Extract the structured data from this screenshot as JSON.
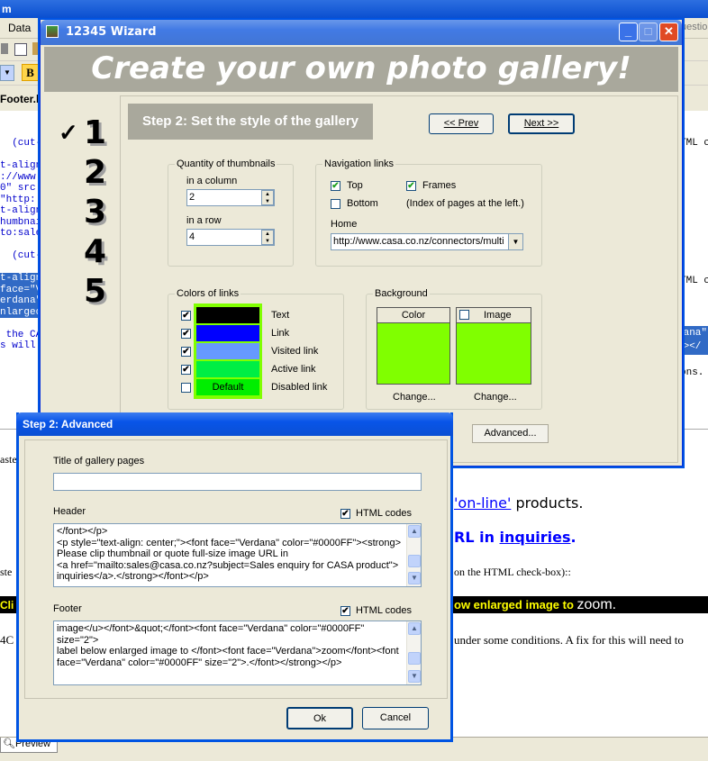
{
  "background_app": {
    "title_fragment": "m",
    "menu_data": "Data",
    "question_fragment": "uestio",
    "file_tab": "Footer.h",
    "bold_button": "B",
    "code_lines_left": [
      {
        "text": "  (cut-",
        "sel": false
      },
      {
        "text": "",
        "sel": false
      },
      {
        "text": "t-align",
        "sel": false
      },
      {
        "text": "://www",
        "sel": false
      },
      {
        "text": "0\" src",
        "sel": false
      },
      {
        "text": "\"http:",
        "sel": false
      },
      {
        "text": "t-align",
        "sel": false
      },
      {
        "text": "humbnai",
        "sel": false
      },
      {
        "text": "to:sale",
        "sel": false
      },
      {
        "text": "",
        "sel": false
      },
      {
        "text": "  (cut-",
        "sel": false
      },
      {
        "text": "",
        "sel": false
      },
      {
        "text": "t-align",
        "sel": true
      },
      {
        "text": "face=\"V",
        "sel": true
      },
      {
        "text": "erdana\"",
        "sel": true
      },
      {
        "text": "nlarged",
        "sel": true
      },
      {
        "text": "",
        "sel": false
      },
      {
        "text": " the CA",
        "sel": false
      },
      {
        "text": "s will",
        "sel": false
      }
    ],
    "right_frag_1": "TML c",
    "right_frag_2": "TML c",
    "right_frag_3": "dana\"",
    "right_frag_4": "<></",
    "right_frag_5": "ons.",
    "preview_fragment_1": "aste",
    "preview_fragment_2": "ste",
    "preview_fragment_3": "Cli",
    "preview_fragment_4": "4C",
    "preview_online_link": "'on-line'",
    "preview_online_rest": " products.",
    "preview_url_a": "RL in ",
    "preview_url_link": "inquiries",
    "preview_url_dot": ".",
    "preview_html_checkbox": "on the HTML check-box)::",
    "preview_black_bar_a": "ow enlarged image to ",
    "preview_black_bar_b": "zoom.",
    "preview_conditions": "under some conditions. A fix for this will need to",
    "preview_tab": "Preview"
  },
  "wizard": {
    "title": "12345 Wizard",
    "banner": "Create your own photo gallery!",
    "steps": [
      "1",
      "2",
      "3",
      "4",
      "5"
    ],
    "step_check": "✓",
    "step_heading": "Step 2:  Set the style of the gallery",
    "prev_label": "<< Prev",
    "next_label": "Next >>",
    "advanced_label": "Advanced...",
    "thumbnails": {
      "legend": "Quantity of thumbnails",
      "column_label": "in a column",
      "column_value": "2",
      "row_label": "in a row",
      "row_value": "4"
    },
    "navigation": {
      "legend": "Navigation links",
      "top": "Top",
      "bottom": "Bottom",
      "frames": "Frames",
      "frames_note": "(Index of pages at the left.)",
      "home_label": "Home",
      "home_value": "http://www.casa.co.nz/connectors/multi"
    },
    "colors": {
      "legend": "Colors of links",
      "items": [
        {
          "label": "Text",
          "color": "#000000",
          "checked": true,
          "swatch_text": ""
        },
        {
          "label": "Link",
          "color": "#0000ff",
          "checked": true,
          "swatch_text": ""
        },
        {
          "label": "Visited link",
          "color": "#6699ff",
          "checked": true,
          "swatch_text": ""
        },
        {
          "label": "Active link",
          "color": "#00ee44",
          "checked": true,
          "swatch_text": ""
        },
        {
          "label": "Disabled link",
          "color": "#00ee00",
          "checked": false,
          "swatch_text": "Default"
        }
      ],
      "frame_color": "#80ff00"
    },
    "background": {
      "legend": "Background",
      "color_label": "Color",
      "image_label": "Image",
      "change_color": "Change...",
      "change_image": "Change...",
      "fill": "#80ff00"
    }
  },
  "advanced": {
    "title": "Step 2: Advanced",
    "gallery_title_label": "Title of gallery pages",
    "gallery_title_value": "",
    "header_label": "Header",
    "header_html_codes": "HTML codes",
    "header_lines": [
      "</font></p>",
      "<p style=\"text-align: center;\"><font face=\"Verdana\" color=\"#0000FF\"><strong>",
      "Please clip thumbnail or quote full-size image URL in",
      "<a href=\"mailto:sales@casa.co.nz?subject=Sales enquiry for CASA product\">",
      "inquiries</a>.</strong></font></p>"
    ],
    "footer_label": "Footer",
    "footer_html_codes": "HTML codes",
    "footer_lines": [
      "image</u></font>&quot;</font><font face=\"Verdana\" color=\"#0000FF\"",
      "size=\"2\">",
      "label below enlarged image to </font><font face=\"Verdana\">zoom</font><font",
      "face=\"Verdana\" color=\"#0000FF\" size=\"2\">.</font></strong></p>"
    ],
    "ok_label": "Ok",
    "cancel_label": "Cancel"
  }
}
